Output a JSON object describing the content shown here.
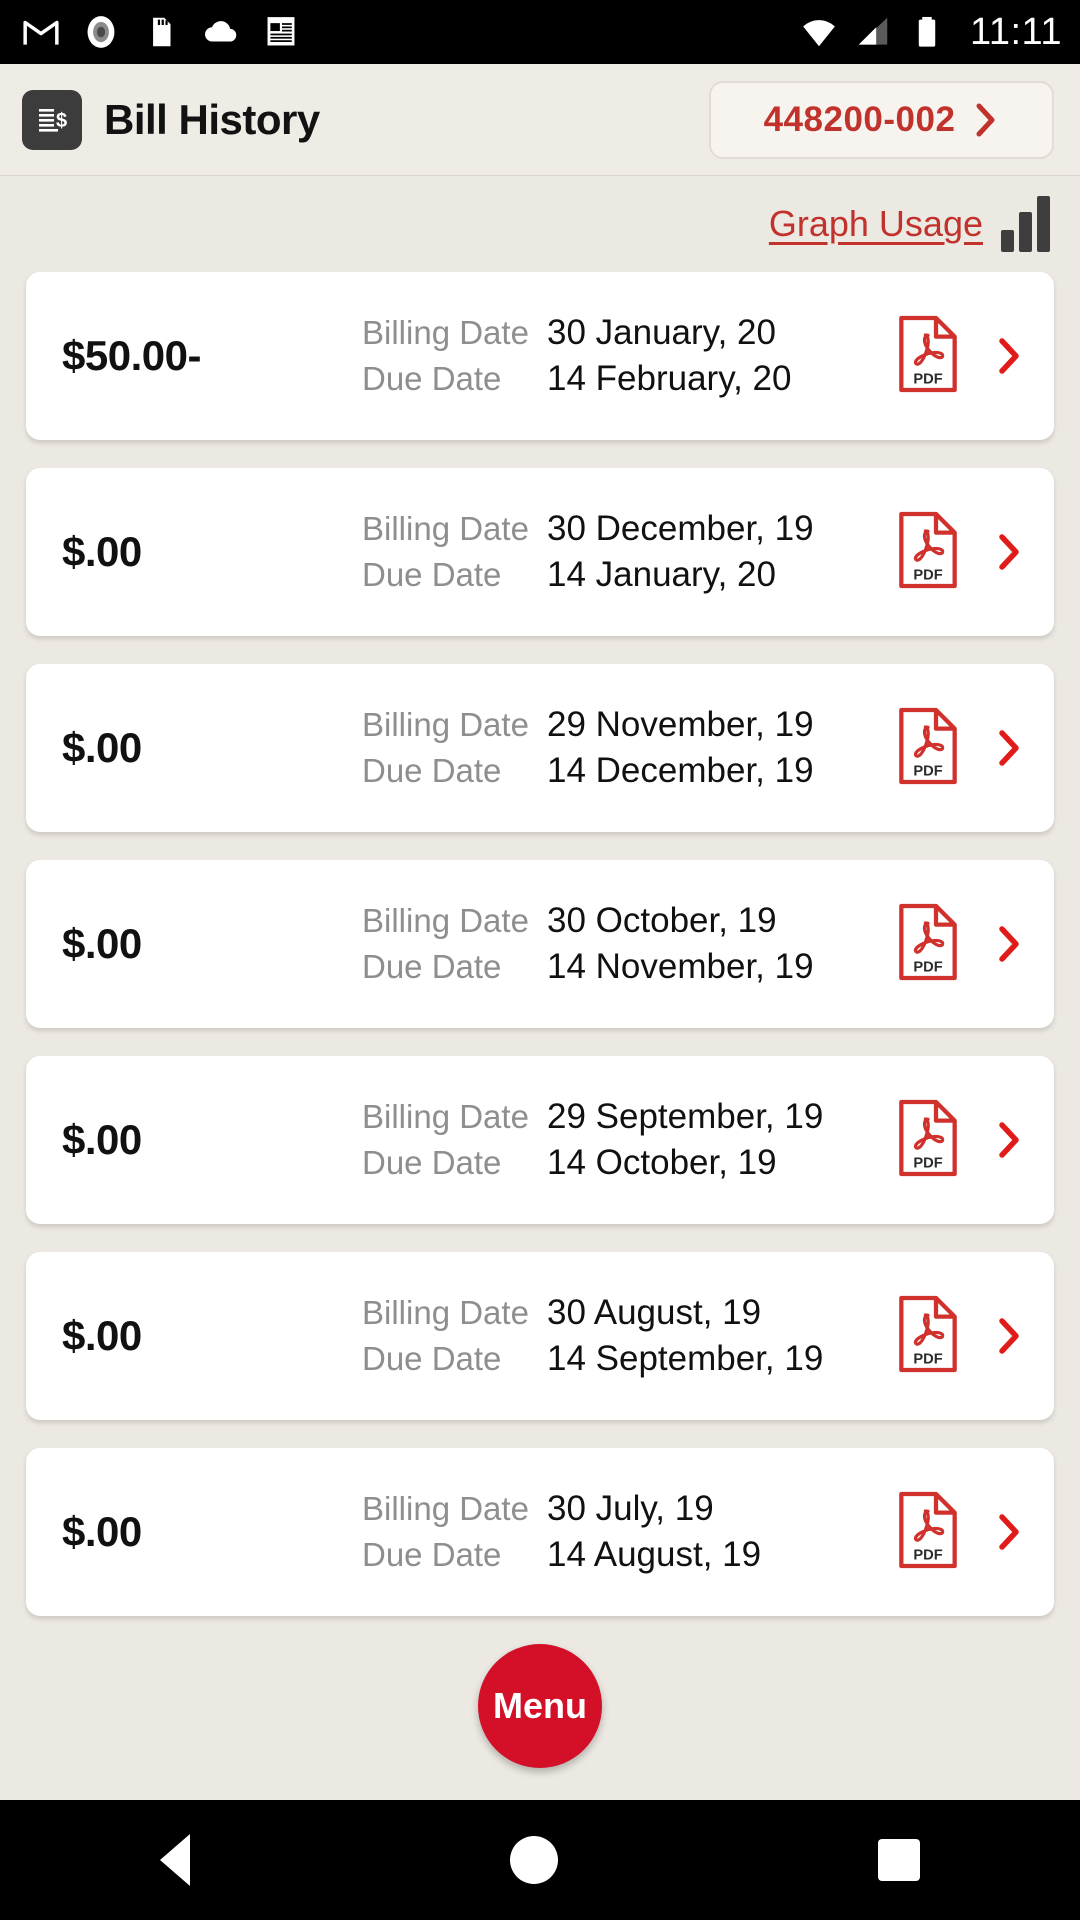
{
  "statusbar": {
    "time": "11:11",
    "left_icons": [
      "gmail-icon",
      "record-icon",
      "sd-card-icon",
      "cloud-icon",
      "news-icon"
    ],
    "right_icons": [
      "wifi-icon",
      "cellular-signal-icon",
      "battery-icon"
    ]
  },
  "header": {
    "title": "Bill History",
    "icon": "bill-dollar-icon",
    "account_number": "448200-002",
    "account_chevron": "chevron-right-icon"
  },
  "usage": {
    "link_label": "Graph Usage",
    "icon": "bar-chart-icon"
  },
  "labels": {
    "billing_date": "Billing Date",
    "due_date": "Due Date",
    "pdf": "PDF"
  },
  "bills": [
    {
      "amount": "$50.00-",
      "billing_date": "30 January, 20",
      "due_date": "14 February, 20"
    },
    {
      "amount": "$.00",
      "billing_date": "30 December, 19",
      "due_date": "14 January, 20"
    },
    {
      "amount": "$.00",
      "billing_date": "29 November, 19",
      "due_date": "14 December, 19"
    },
    {
      "amount": "$.00",
      "billing_date": "30 October, 19",
      "due_date": "14 November, 19"
    },
    {
      "amount": "$.00",
      "billing_date": "29 September, 19",
      "due_date": "14 October, 19"
    },
    {
      "amount": "$.00",
      "billing_date": "30 August, 19",
      "due_date": "14 September, 19"
    },
    {
      "amount": "$.00",
      "billing_date": "30 July, 19",
      "due_date": "14 August, 19"
    }
  ],
  "fab": {
    "label": "Menu"
  },
  "navbar": {
    "back": "back-icon",
    "home": "home-icon",
    "recents": "recents-icon"
  },
  "colors": {
    "brand_red": "#C0322B",
    "fab_red": "#D31027",
    "background": "#ECE8E2",
    "card": "#FFFFFF",
    "label_gray": "#8E8E8E"
  }
}
